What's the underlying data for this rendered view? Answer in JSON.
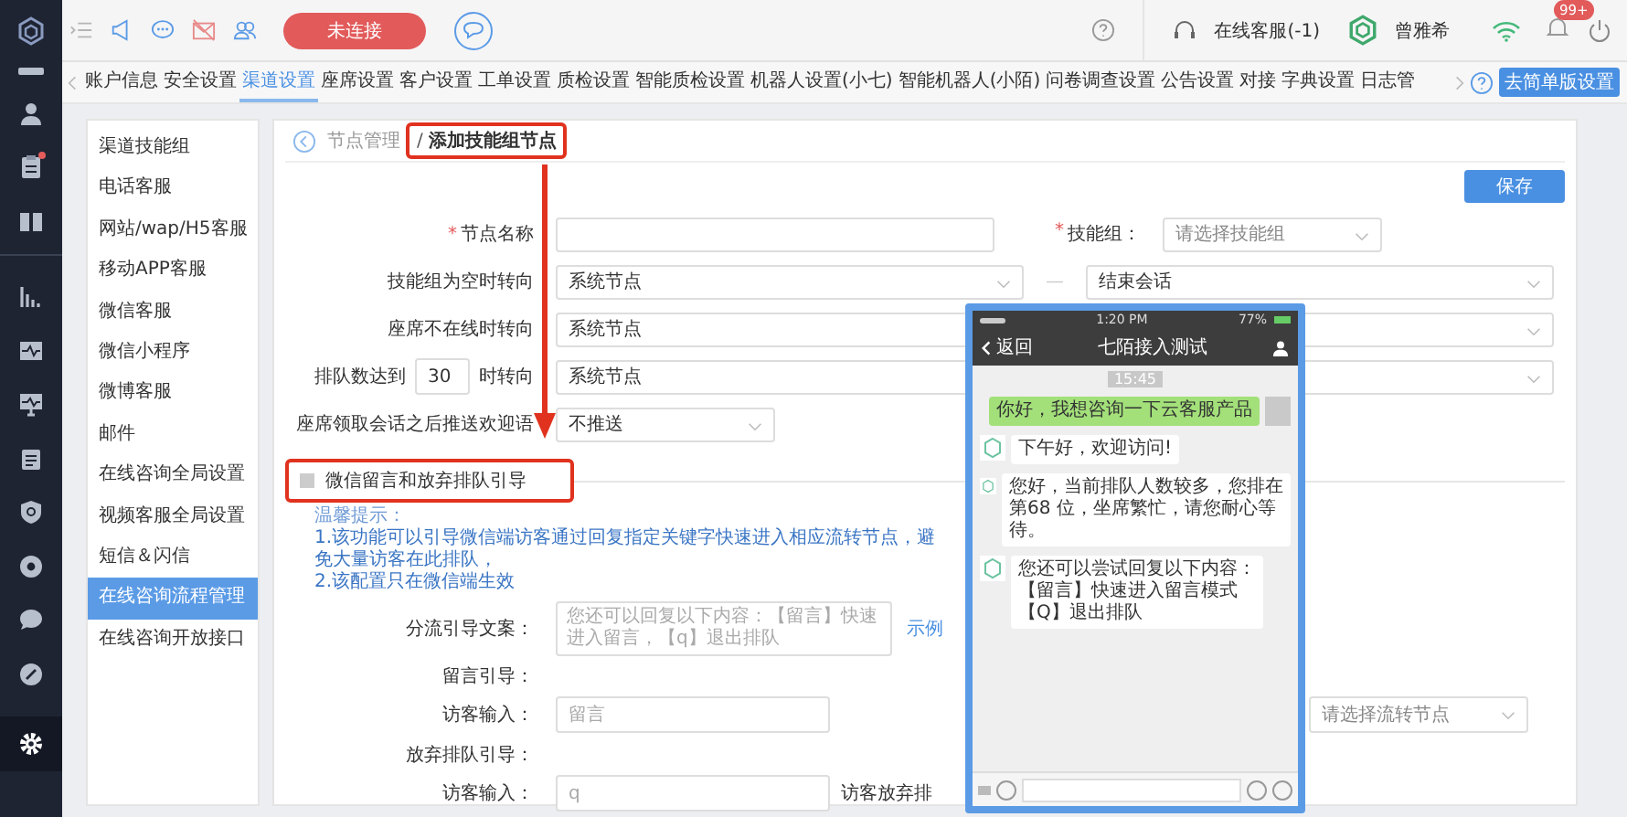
{
  "rail": [
    {
      "selected": false,
      "badge": false
    },
    {
      "selected": false,
      "badge": true
    },
    {
      "selected": false,
      "badge": false
    },
    {
      "selected": false,
      "badge": false
    },
    {
      "selected": false,
      "badge": false
    },
    {
      "selected": false,
      "badge": false
    },
    {
      "selected": false,
      "badge": false
    },
    {
      "selected": false,
      "badge": false
    },
    {
      "selected": false,
      "badge": false
    },
    {
      "selected": false,
      "badge": false
    },
    {
      "selected": false,
      "badge": false
    },
    {
      "selected": true,
      "badge": false
    }
  ],
  "toolbar": {
    "status_button": "未连接",
    "agent_status": "在线客服(-1)",
    "user_name": "曾雅希",
    "notification_count": "99+"
  },
  "tabs": [
    {
      "label": "账户信息",
      "selected": false
    },
    {
      "label": "安全设置",
      "selected": false
    },
    {
      "label": "渠道设置",
      "selected": true
    },
    {
      "label": "座席设置",
      "selected": false
    },
    {
      "label": "客户设置",
      "selected": false
    },
    {
      "label": "工单设置",
      "selected": false
    },
    {
      "label": "质检设置",
      "selected": false
    },
    {
      "label": "智能质检设置",
      "selected": false
    },
    {
      "label": "机器人设置(小七)",
      "selected": false
    },
    {
      "label": "智能机器人(小陌)",
      "selected": false
    },
    {
      "label": "问卷调查设置",
      "selected": false
    },
    {
      "label": "公告设置",
      "selected": false
    },
    {
      "label": "对接",
      "selected": false
    },
    {
      "label": "字典设置",
      "selected": false
    },
    {
      "label": "日志管",
      "selected": false
    }
  ],
  "simple_mode_button": "去简单版设置",
  "sidebar": {
    "items": [
      {
        "label": "渠道技能组",
        "selected": false
      },
      {
        "label": "电话客服",
        "selected": false
      },
      {
        "label": "网站/wap/H5客服",
        "selected": false
      },
      {
        "label": "移动APP客服",
        "selected": false
      },
      {
        "label": "微信客服",
        "selected": false
      },
      {
        "label": "微信小程序",
        "selected": false
      },
      {
        "label": "微博客服",
        "selected": false
      },
      {
        "label": "邮件",
        "selected": false
      },
      {
        "label": "在线咨询全局设置",
        "selected": false
      },
      {
        "label": "视频客服全局设置",
        "selected": false
      },
      {
        "label": "短信＆闪信",
        "selected": false
      },
      {
        "label": "在线咨询流程管理",
        "selected": true
      },
      {
        "label": "在线咨询开放接口",
        "selected": false
      }
    ]
  },
  "breadcrumb": {
    "parent": "节点管理",
    "separator": "/",
    "current": "添加技能组节点"
  },
  "save_button": "保存",
  "form": {
    "node_name": {
      "mark": "*",
      "label": "节点名称"
    },
    "skill_group": {
      "mark": "*",
      "label": "技能组：",
      "placeholder": "请选择技能组"
    },
    "empty_group_route": {
      "label": "技能组为空时转向",
      "value": "系统节点",
      "separator": "—",
      "target": "结束会话"
    },
    "offline_route": {
      "label": "座席不在线时转向",
      "value": "系统节点"
    },
    "queue_route": {
      "label_before": "排队数达到",
      "count": "30",
      "label_after": "时转向",
      "value": "系统节点"
    },
    "welcome": {
      "label": "座席领取会话之后推送欢迎语",
      "value": "不推送"
    }
  },
  "guide_section": {
    "checked": false,
    "title": "微信留言和放弃排队引导",
    "tips_title": "温馨提示：",
    "tips": [
      "1.该功能可以引导微信端访客通过回复指定关键字快速进入相应流转节点，避免大量访客在此排队，",
      "2.该配置只在微信端生效"
    ],
    "copy_label": "分流引导文案：",
    "copy_placeholder": "您还可以回复以下内容：【留言】快速进入留言，【q】退出排队",
    "example_link": "示例",
    "message_heading": "留言引导：",
    "message_input_label": "访客输入：",
    "message_placeholder": "留言",
    "message_target_placeholder": "请选择流转节点",
    "abandon_heading": "放弃排队引导：",
    "abandon_input_label": "访客输入：",
    "abandon_placeholder": "q",
    "abandon_note": "访客放弃排"
  },
  "phone_preview": {
    "time": "1:20 PM",
    "battery": "77%",
    "back": "返回",
    "title": "七陌接入测试",
    "timestamp": "15:45",
    "messages": [
      {
        "kind": "visitor",
        "lines": [
          "你好，我想咨询一下云客服产品"
        ]
      },
      {
        "kind": "bot",
        "lines": [
          "下午好，欢迎访问!"
        ]
      },
      {
        "kind": "bot",
        "lines": [
          "您好，当前排队人数较多，您排在第68 位，坐席繁忙，请您耐心等待。"
        ]
      },
      {
        "kind": "bot",
        "lines": [
          "您还可以尝试回复以下内容：",
          "【留言】快速进入留言模式",
          "【Q】退出排队"
        ]
      }
    ]
  }
}
